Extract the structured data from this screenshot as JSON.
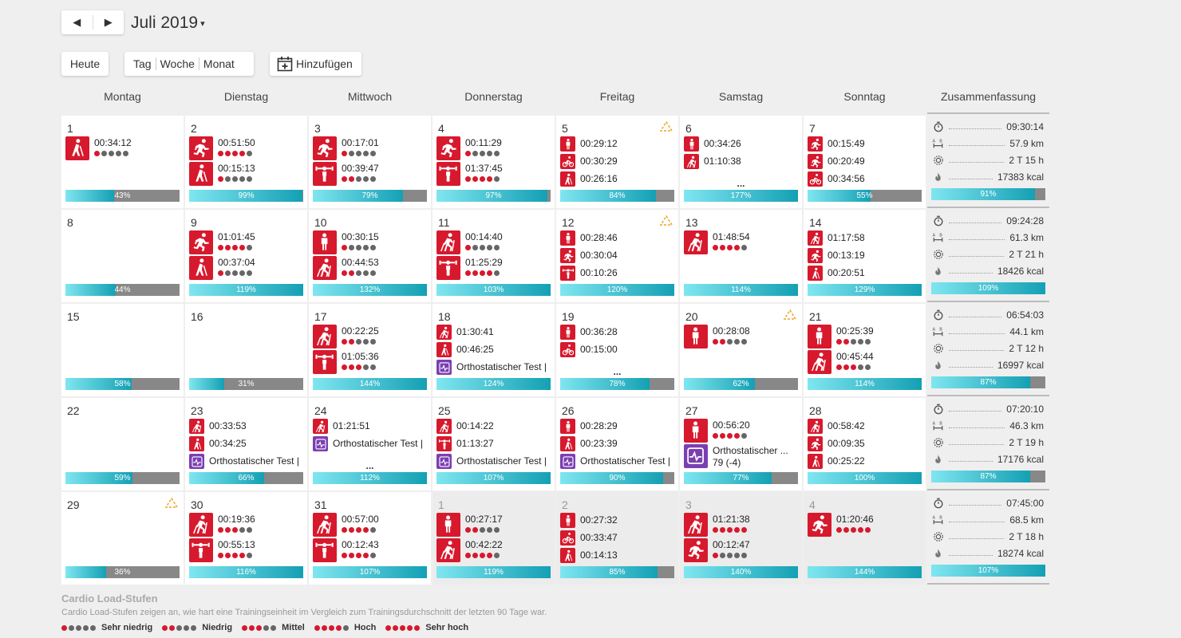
{
  "header": {
    "prev_icon": "chevron-left-icon",
    "next_icon": "chevron-right-icon",
    "month_label": "Juli 2019",
    "caret": "▾",
    "today_label": "Heute",
    "views": [
      "Tag",
      "Woche",
      "Monat"
    ],
    "add_label": "Hinzufügen",
    "add_icon": "calendar-add-icon"
  },
  "weekdays": [
    "Montag",
    "Dienstag",
    "Mittwoch",
    "Donnerstag",
    "Freitag",
    "Samstag",
    "Sonntag"
  ],
  "summary_label": "Zusammenfassung",
  "colors": {
    "load": "#d7192d",
    "test": "#7b3fb2",
    "dot_off": "#666666",
    "bar_fill": "#14a0b4",
    "bar_bg": "#888888",
    "warning": "#f0a020"
  },
  "weeks": [
    {
      "days": [
        {
          "date": "1",
          "warning": false,
          "acts": [
            {
              "icon": "hiking-icon",
              "time": "00:34:12",
              "load": 1
            }
          ],
          "bar": {
            "label": "43%",
            "value": 43
          }
        },
        {
          "date": "2",
          "warning": false,
          "acts": [
            {
              "icon": "running-icon",
              "time": "00:51:50",
              "load": 4
            },
            {
              "icon": "hiking-icon",
              "time": "00:15:13",
              "load": 1
            }
          ],
          "bar": {
            "label": "99%",
            "value": 99
          }
        },
        {
          "date": "3",
          "warning": false,
          "acts": [
            {
              "icon": "running-icon",
              "time": "00:17:01",
              "load": 1
            },
            {
              "icon": "strength-icon",
              "time": "00:39:47",
              "load": 2
            }
          ],
          "bar": {
            "label": "79%",
            "value": 79
          }
        },
        {
          "date": "4",
          "warning": false,
          "acts": [
            {
              "icon": "running-icon",
              "time": "00:11:29",
              "load": 1
            },
            {
              "icon": "strength-icon",
              "time": "01:37:45",
              "load": 4
            }
          ],
          "bar": {
            "label": "97%",
            "value": 97
          }
        },
        {
          "date": "5",
          "warning": true,
          "acts": [
            {
              "icon": "standing-icon",
              "time": "00:29:12"
            },
            {
              "icon": "cycling-icon",
              "time": "00:30:29"
            },
            {
              "icon": "hiking-icon",
              "time": "00:26:16"
            }
          ],
          "bar": {
            "label": "84%",
            "value": 84
          }
        },
        {
          "date": "6",
          "warning": false,
          "acts": [
            {
              "icon": "standing-icon",
              "time": "00:34:26"
            },
            {
              "icon": "nordic-walking-icon",
              "time": "01:10:38"
            }
          ],
          "more": "...",
          "bar": {
            "label": "177%",
            "value": 177
          }
        },
        {
          "date": "7",
          "warning": false,
          "acts": [
            {
              "icon": "running-icon",
              "time": "00:15:49"
            },
            {
              "icon": "running-icon",
              "time": "00:20:49"
            },
            {
              "icon": "cycling-icon",
              "time": "00:34:56"
            }
          ],
          "bar": {
            "label": "55%",
            "value": 55
          }
        }
      ],
      "summary": {
        "duration": "09:30:14",
        "distance": "57.9 km",
        "recovery": "2 T 15 h",
        "calories": "17383 kcal",
        "bar": {
          "label": "91%",
          "value": 91
        }
      }
    },
    {
      "days": [
        {
          "date": "8",
          "warning": false,
          "acts": [],
          "bar": {
            "label": "44%",
            "value": 44
          }
        },
        {
          "date": "9",
          "warning": false,
          "acts": [
            {
              "icon": "running-icon",
              "time": "01:01:45",
              "load": 4
            },
            {
              "icon": "hiking-icon",
              "time": "00:37:04",
              "load": 1
            }
          ],
          "bar": {
            "label": "119%",
            "value": 119
          }
        },
        {
          "date": "10",
          "warning": false,
          "acts": [
            {
              "icon": "standing-icon",
              "time": "00:30:15",
              "load": 1
            },
            {
              "icon": "nordic-walking-icon",
              "time": "00:44:53",
              "load": 2
            }
          ],
          "bar": {
            "label": "132%",
            "value": 132
          }
        },
        {
          "date": "11",
          "warning": false,
          "acts": [
            {
              "icon": "nordic-walking-icon",
              "time": "00:14:40",
              "load": 1
            },
            {
              "icon": "strength-icon",
              "time": "01:25:29",
              "load": 4
            }
          ],
          "bar": {
            "label": "103%",
            "value": 103
          }
        },
        {
          "date": "12",
          "warning": true,
          "acts": [
            {
              "icon": "standing-icon",
              "time": "00:28:46"
            },
            {
              "icon": "running-icon",
              "time": "00:30:04"
            },
            {
              "icon": "strength-icon",
              "time": "00:10:26"
            }
          ],
          "bar": {
            "label": "120%",
            "value": 120
          }
        },
        {
          "date": "13",
          "warning": false,
          "acts": [
            {
              "icon": "nordic-walking-icon",
              "time": "01:48:54",
              "load": 4
            }
          ],
          "bar": {
            "label": "114%",
            "value": 114
          }
        },
        {
          "date": "14",
          "warning": false,
          "acts": [
            {
              "icon": "nordic-walking-icon",
              "time": "01:17:58"
            },
            {
              "icon": "running-icon",
              "time": "00:13:19"
            },
            {
              "icon": "hiking-icon",
              "time": "00:20:51"
            }
          ],
          "bar": {
            "label": "129%",
            "value": 129
          }
        }
      ],
      "summary": {
        "duration": "09:24:28",
        "distance": "61.3 km",
        "recovery": "2 T 21 h",
        "calories": "18426 kcal",
        "bar": {
          "label": "109%",
          "value": 109
        }
      }
    },
    {
      "days": [
        {
          "date": "15",
          "warning": false,
          "acts": [],
          "bar": {
            "label": "58%",
            "value": 58
          }
        },
        {
          "date": "16",
          "warning": false,
          "acts": [],
          "bar": {
            "label": "31%",
            "value": 31
          }
        },
        {
          "date": "17",
          "warning": false,
          "acts": [
            {
              "icon": "nordic-walking-icon",
              "time": "00:22:25",
              "load": 2
            },
            {
              "icon": "strength-icon",
              "time": "01:05:36",
              "load": 3
            }
          ],
          "bar": {
            "label": "144%",
            "value": 144
          }
        },
        {
          "date": "18",
          "warning": false,
          "acts": [
            {
              "icon": "nordic-walking-icon",
              "time": "01:30:41"
            },
            {
              "icon": "hiking-icon",
              "time": "00:46:25"
            },
            {
              "icon": "orthostatic-test-icon",
              "time": "Orthostatischer Test |",
              "purple": true
            }
          ],
          "bar": {
            "label": "124%",
            "value": 124
          }
        },
        {
          "date": "19",
          "warning": false,
          "acts": [
            {
              "icon": "standing-icon",
              "time": "00:36:28"
            },
            {
              "icon": "cycling-icon",
              "time": "00:15:00"
            }
          ],
          "more": "...",
          "bar": {
            "label": "78%",
            "value": 78
          }
        },
        {
          "date": "20",
          "warning": true,
          "acts": [
            {
              "icon": "standing-icon",
              "time": "00:28:08",
              "load": 2
            }
          ],
          "bar": {
            "label": "62%",
            "value": 62
          }
        },
        {
          "date": "21",
          "warning": false,
          "acts": [
            {
              "icon": "standing-icon",
              "time": "00:25:39",
              "load": 2
            },
            {
              "icon": "nordic-walking-icon",
              "time": "00:45:44",
              "load": 3
            }
          ],
          "bar": {
            "label": "114%",
            "value": 114
          }
        }
      ],
      "summary": {
        "duration": "06:54:03",
        "distance": "44.1 km",
        "recovery": "2 T 12 h",
        "calories": "16997 kcal",
        "bar": {
          "label": "87%",
          "value": 87
        }
      }
    },
    {
      "days": [
        {
          "date": "22",
          "warning": false,
          "acts": [],
          "bar": {
            "label": "59%",
            "value": 59
          }
        },
        {
          "date": "23",
          "warning": false,
          "acts": [
            {
              "icon": "nordic-walking-icon",
              "time": "00:33:53"
            },
            {
              "icon": "hiking-icon",
              "time": "00:34:25"
            },
            {
              "icon": "orthostatic-test-icon",
              "time": "Orthostatischer Test |",
              "purple": true
            }
          ],
          "bar": {
            "label": "66%",
            "value": 66
          }
        },
        {
          "date": "24",
          "warning": false,
          "acts": [
            {
              "icon": "nordic-walking-icon",
              "time": "01:21:51"
            },
            {
              "icon": "orthostatic-test-icon",
              "time": "Orthostatischer Test |",
              "purple": true
            }
          ],
          "more": "...",
          "bar": {
            "label": "112%",
            "value": 112
          }
        },
        {
          "date": "25",
          "warning": false,
          "acts": [
            {
              "icon": "nordic-walking-icon",
              "time": "00:14:22"
            },
            {
              "icon": "strength-icon",
              "time": "01:13:27"
            },
            {
              "icon": "orthostatic-test-icon",
              "time": "Orthostatischer Test |",
              "purple": true
            }
          ],
          "bar": {
            "label": "107%",
            "value": 107
          }
        },
        {
          "date": "26",
          "warning": false,
          "acts": [
            {
              "icon": "standing-icon",
              "time": "00:28:29"
            },
            {
              "icon": "hiking-icon",
              "time": "00:23:39"
            },
            {
              "icon": "orthostatic-test-icon",
              "time": "Orthostatischer Test |",
              "purple": true
            }
          ],
          "bar": {
            "label": "90%",
            "value": 90
          }
        },
        {
          "date": "27",
          "warning": false,
          "acts": [
            {
              "icon": "standing-icon",
              "time": "00:56:20",
              "load": 4
            },
            {
              "icon": "orthostatic-test-icon",
              "time": "Orthostatischer ...",
              "sub": "79 (-4)",
              "purple": true
            }
          ],
          "bar": {
            "label": "77%",
            "value": 77
          }
        },
        {
          "date": "28",
          "warning": false,
          "acts": [
            {
              "icon": "nordic-walking-icon",
              "time": "00:58:42"
            },
            {
              "icon": "running-icon",
              "time": "00:09:35"
            },
            {
              "icon": "hiking-icon",
              "time": "00:25:22"
            }
          ],
          "bar": {
            "label": "100%",
            "value": 100
          }
        }
      ],
      "summary": {
        "duration": "07:20:10",
        "distance": "46.3 km",
        "recovery": "2 T 19 h",
        "calories": "17176 kcal",
        "bar": {
          "label": "87%",
          "value": 87
        }
      }
    },
    {
      "days": [
        {
          "date": "29",
          "warning": true,
          "acts": [],
          "bar": {
            "label": "36%",
            "value": 36
          }
        },
        {
          "date": "30",
          "warning": false,
          "acts": [
            {
              "icon": "nordic-walking-icon",
              "time": "00:19:36",
              "load": 3
            },
            {
              "icon": "strength-icon",
              "time": "00:55:13",
              "load": 4
            }
          ],
          "bar": {
            "label": "116%",
            "value": 116
          }
        },
        {
          "date": "31",
          "warning": false,
          "acts": [
            {
              "icon": "nordic-walking-icon",
              "time": "00:57:00",
              "load": 4
            },
            {
              "icon": "strength-icon",
              "time": "00:12:43",
              "load": 4
            }
          ],
          "bar": {
            "label": "107%",
            "value": 107
          }
        },
        {
          "date": "1",
          "next": true,
          "warning": false,
          "acts": [
            {
              "icon": "standing-icon",
              "time": "00:27:17",
              "load": 2
            },
            {
              "icon": "nordic-walking-icon",
              "time": "00:42:22",
              "load": 4
            }
          ],
          "bar": {
            "label": "119%",
            "value": 119
          }
        },
        {
          "date": "2",
          "next": true,
          "warning": false,
          "acts": [
            {
              "icon": "standing-icon",
              "time": "00:27:32"
            },
            {
              "icon": "cycling-icon",
              "time": "00:33:47"
            },
            {
              "icon": "hiking-icon",
              "time": "00:14:13"
            }
          ],
          "bar": {
            "label": "85%",
            "value": 85
          }
        },
        {
          "date": "3",
          "next": true,
          "warning": false,
          "acts": [
            {
              "icon": "nordic-walking-icon",
              "time": "01:21:38",
              "load": 5
            },
            {
              "icon": "running-icon",
              "time": "00:12:47",
              "load": 1
            }
          ],
          "bar": {
            "label": "140%",
            "value": 140
          }
        },
        {
          "date": "4",
          "next": true,
          "warning": false,
          "acts": [
            {
              "icon": "running-icon",
              "time": "01:20:46",
              "load": 5
            }
          ],
          "bar": {
            "label": "144%",
            "value": 144
          }
        }
      ],
      "summary": {
        "duration": "07:45:00",
        "distance": "68.5 km",
        "recovery": "2 T 18 h",
        "calories": "18274 kcal",
        "bar": {
          "label": "107%",
          "value": 107
        }
      }
    }
  ],
  "legend": {
    "title": "Cardio Load-Stufen",
    "description": "Cardio Load-Stufen zeigen an, wie hart eine Trainingseinheit im Vergleich zum Trainingsdurchschnitt der letzten 90 Tage war.",
    "levels": [
      {
        "label": "Sehr niedrig",
        "value": 1
      },
      {
        "label": "Niedrig",
        "value": 2
      },
      {
        "label": "Mittel",
        "value": 3
      },
      {
        "label": "Hoch",
        "value": 4
      },
      {
        "label": "Sehr hoch",
        "value": 5
      }
    ]
  }
}
